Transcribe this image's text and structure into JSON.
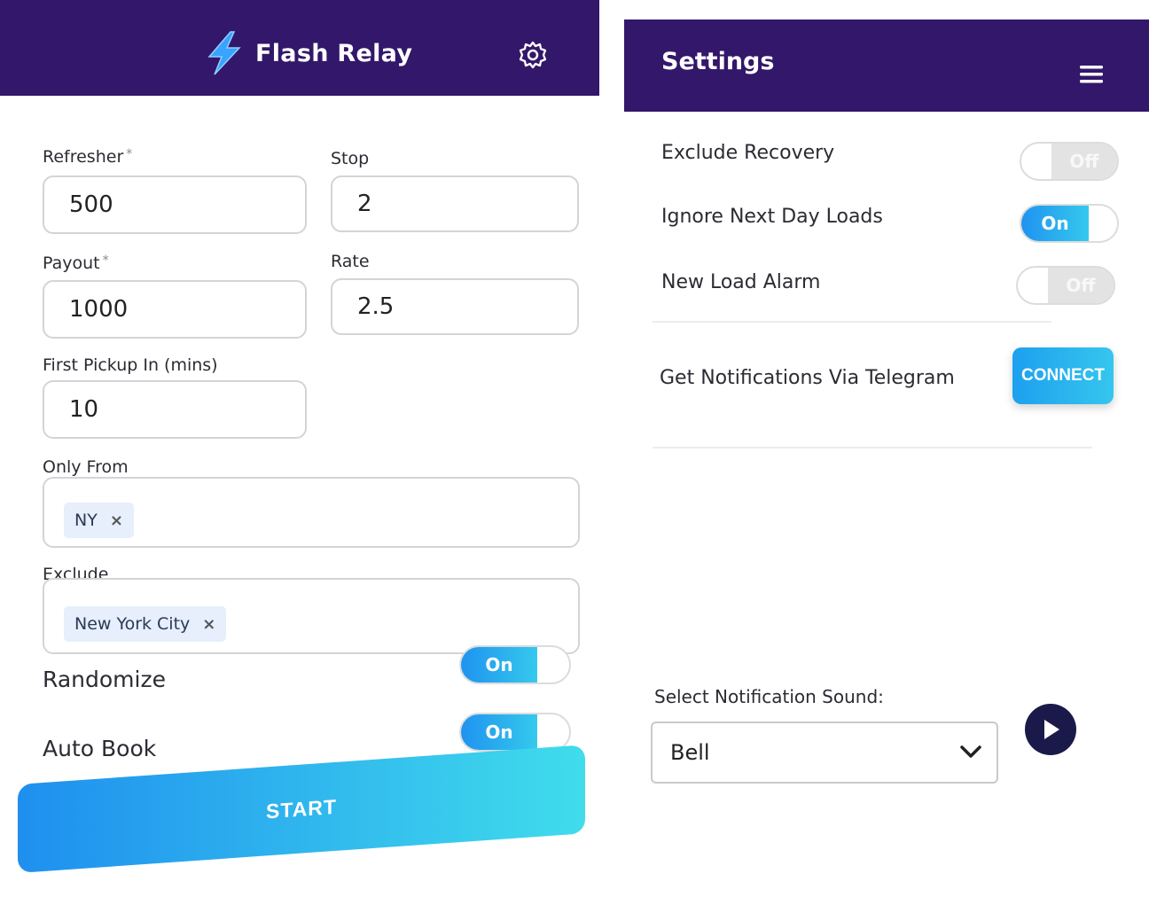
{
  "app": {
    "title": "Flash Relay"
  },
  "form": {
    "refresher": {
      "label": "Refresher",
      "required": "*",
      "value": "500"
    },
    "stop": {
      "label": "Stop",
      "value": "2"
    },
    "payout": {
      "label": "Payout",
      "required": "*",
      "value": "1000"
    },
    "rate": {
      "label": "Rate",
      "value": "2.5"
    },
    "first_pickup": {
      "label": "First Pickup In (mins)",
      "value": "10"
    },
    "only_from": {
      "label": "Only From",
      "chips": [
        "NY"
      ]
    },
    "exclude": {
      "label": "Exclude",
      "chips": [
        "New York City"
      ]
    },
    "randomize": {
      "label": "Randomize",
      "state": "On"
    },
    "auto_book": {
      "label": "Auto Book",
      "state": "On"
    },
    "start_label": "START",
    "chip_remove": "×"
  },
  "settings": {
    "title": "Settings",
    "exclude_recovery": {
      "label": "Exclude Recovery",
      "state": "Off"
    },
    "ignore_next_day": {
      "label": "Ignore Next Day Loads",
      "state": "On"
    },
    "new_load_alarm": {
      "label": "New Load Alarm",
      "state": "Off"
    },
    "telegram": {
      "label": "Get Notifications Via Telegram",
      "button": "CONNECT"
    },
    "sound": {
      "label": "Select Notification Sound:",
      "selected": "Bell"
    }
  },
  "colors": {
    "header": "#33176a",
    "accent": "#1f93ef",
    "accent_end": "#40dcec",
    "play": "#1a1a4a"
  },
  "icons": {
    "logo": "lightning-bolt",
    "settings": "gear",
    "menu": "hamburger",
    "select": "chevron-down",
    "play": "play"
  }
}
